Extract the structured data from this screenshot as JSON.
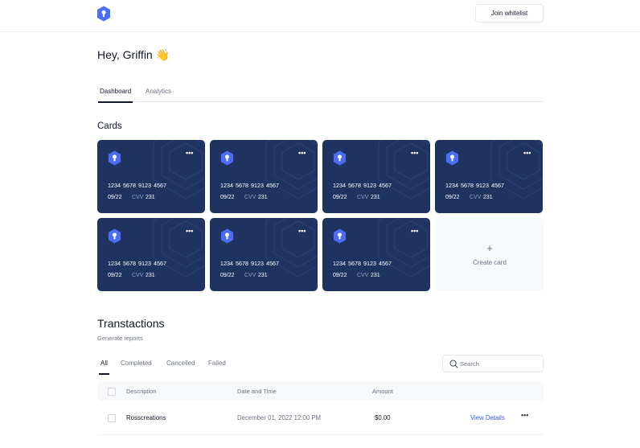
{
  "header": {
    "join_label": "Join whitelist"
  },
  "greeting": {
    "text": "Hey, Griffin 👋"
  },
  "main_tabs": [
    {
      "label": "Dashboard",
      "active": true
    },
    {
      "label": "Analytics",
      "active": false
    }
  ],
  "cards_section": {
    "title": "Cards",
    "cards": [
      {
        "number": "1234 5678 9123 4567",
        "expiry": "09/22",
        "cvv_label": "CVV",
        "cvv": "231"
      },
      {
        "number": "1234 5678 9123 4567",
        "expiry": "09/22",
        "cvv_label": "CVV",
        "cvv": "231"
      },
      {
        "number": "1234 5678 9123 4567",
        "expiry": "09/22",
        "cvv_label": "CVV",
        "cvv": "231"
      },
      {
        "number": "1234 5678 9123 4567",
        "expiry": "09/22",
        "cvv_label": "CVV",
        "cvv": "231"
      },
      {
        "number": "1234 5678 9123 4567",
        "expiry": "09/22",
        "cvv_label": "CVV",
        "cvv": "231"
      },
      {
        "number": "1234 5678 9123 4567",
        "expiry": "09/22",
        "cvv_label": "CVV",
        "cvv": "231"
      },
      {
        "number": "1234 5678 9123 4567",
        "expiry": "09/22",
        "cvv_label": "CVV",
        "cvv": "231"
      }
    ],
    "create_label": "Create card",
    "create_icon": "+"
  },
  "transactions": {
    "title": "Transtactions",
    "subtitle": "Generate reports",
    "tabs": [
      {
        "label": "All",
        "active": true
      },
      {
        "label": "Completed",
        "active": false
      },
      {
        "label": "Cancelled",
        "active": false
      },
      {
        "label": "Failed",
        "active": false
      }
    ],
    "search_placeholder": "Search",
    "columns": [
      "Description",
      "Date and Time",
      "Amount"
    ],
    "rows": [
      {
        "description": "Rosscreations",
        "datetime": "December 01, 2022 12:00 PM",
        "amount": "$0.00",
        "action": "View Details"
      }
    ]
  },
  "icons": {
    "logo": "hexagon-keyhole-icon",
    "card_menu": "more-horizontal-icon",
    "search": "search-icon"
  },
  "colors": {
    "card_bg": "#1f3361",
    "brand": "#4a6cf7",
    "link": "#3b5bdb"
  }
}
